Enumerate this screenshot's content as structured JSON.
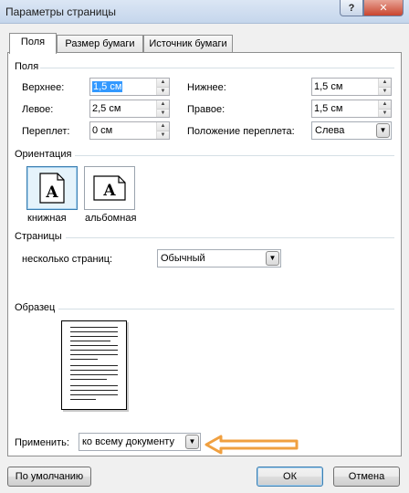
{
  "window": {
    "title": "Параметры страницы",
    "help_glyph": "?",
    "close_glyph": "✕"
  },
  "tabs": [
    {
      "label": "Поля",
      "active": true
    },
    {
      "label": "Размер бумаги",
      "active": false
    },
    {
      "label": "Источник бумаги",
      "active": false
    }
  ],
  "margins": {
    "group_label": "Поля",
    "top_label": "Верхнее:",
    "top_value": "1,5 см",
    "bottom_label": "Нижнее:",
    "bottom_value": "1,5 см",
    "left_label": "Левое:",
    "left_value": "2,5 см",
    "right_label": "Правое:",
    "right_value": "1,5 см",
    "gutter_label": "Переплет:",
    "gutter_value": "0 см",
    "gutter_pos_label": "Положение переплета:",
    "gutter_pos_value": "Слева"
  },
  "orientation": {
    "group_label": "Ориентация",
    "portrait_label": "книжная",
    "landscape_label": "альбомная",
    "icon_letter": "A",
    "selected": "portrait"
  },
  "pages": {
    "group_label": "Страницы",
    "multiple_label": "несколько страниц:",
    "multiple_value": "Обычный"
  },
  "preview": {
    "group_label": "Образец"
  },
  "apply": {
    "label": "Применить:",
    "value": "ко всему документу"
  },
  "buttons": {
    "default_label": "По умолчанию",
    "ok_label": "ОК",
    "cancel_label": "Отмена"
  },
  "colors": {
    "annotation_arrow": "#f0a040",
    "selection": "#3399ff",
    "title_bar": "#c5d6ec"
  }
}
